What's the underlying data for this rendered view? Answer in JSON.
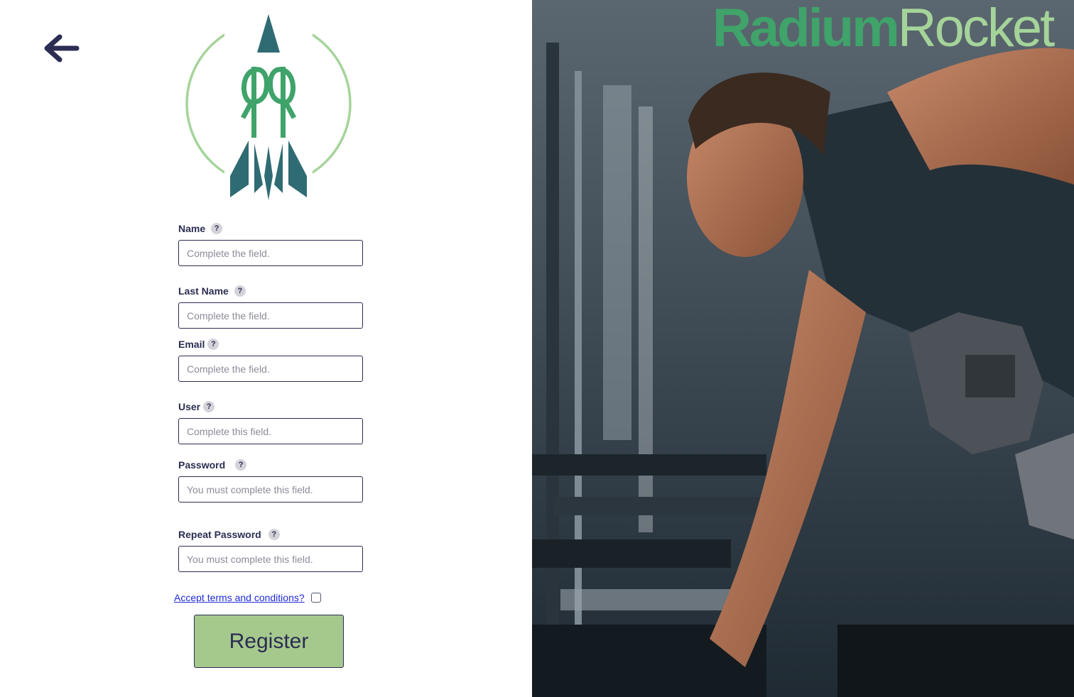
{
  "icons": {
    "back": "arrow-left-icon",
    "logo": "rocket-logo-icon",
    "help": "question-mark-icon"
  },
  "colors": {
    "primary_text": "#2b2d52",
    "accent_green": "#3fa36a",
    "light_green": "#a5d49a",
    "button_bg": "#a5c98d",
    "logo_teal": "#2f6b73",
    "link": "#1f2bd6"
  },
  "form": {
    "help_symbol": "?",
    "fields": [
      {
        "label": "Name",
        "placeholder": "Complete the field."
      },
      {
        "label": "Last Name",
        "placeholder": "Complete the field."
      },
      {
        "label": "Email",
        "placeholder": "Complete the field."
      },
      {
        "label": "User",
        "placeholder": "Complete this field."
      },
      {
        "label": "Password",
        "placeholder": "You must complete this field."
      },
      {
        "label": "Repeat Password",
        "placeholder": "You must complete this field."
      }
    ],
    "terms_label": "Accept terms and conditions?",
    "submit_label": "Register"
  },
  "brand": {
    "part1": "Radium",
    "part2": "Rocket"
  }
}
